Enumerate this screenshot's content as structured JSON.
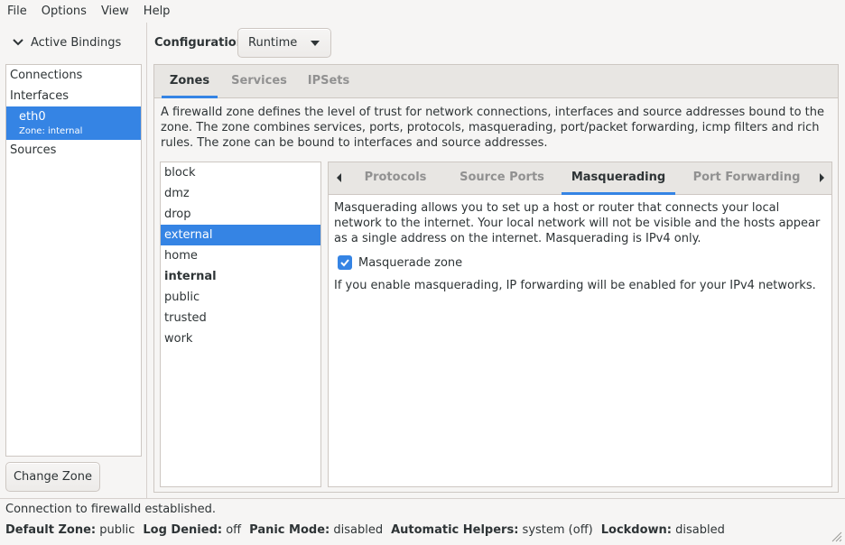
{
  "menu": [
    "File",
    "Options",
    "View",
    "Help"
  ],
  "bindings": {
    "toggle_label": "Active Bindings",
    "items": [
      {
        "label": "Connections"
      },
      {
        "label": "Interfaces"
      },
      {
        "label": "eth0",
        "sub": "Zone: internal",
        "selected": true
      },
      {
        "label": "Sources"
      }
    ],
    "change_zone_label": "Change Zone"
  },
  "config": {
    "label": "Configuration:",
    "value": "Runtime"
  },
  "main_tabs": [
    "Zones",
    "Services",
    "IPSets"
  ],
  "zone_description": "A firewalld zone defines the level of trust for network connections, interfaces and source addresses bound to the zone. The zone combines services, ports, protocols, masquerading, port/packet forwarding, icmp filters and rich rules. The zone can be bound to interfaces and source addresses.",
  "zones": [
    {
      "name": "block"
    },
    {
      "name": "dmz"
    },
    {
      "name": "drop"
    },
    {
      "name": "external",
      "selected": true
    },
    {
      "name": "home"
    },
    {
      "name": "internal",
      "bold": true
    },
    {
      "name": "public"
    },
    {
      "name": "trusted"
    },
    {
      "name": "work"
    }
  ],
  "sub_tabs": [
    "Protocols",
    "Source Ports",
    "Masquerading",
    "Port Forwarding"
  ],
  "masquerading": {
    "description": "Masquerading allows you to set up a host or router that connects your local network to the internet. Your local network will not be visible and the hosts appear as a single address on the internet. Masquerading is IPv4 only.",
    "checkbox_label": "Masquerade zone",
    "checked": true,
    "note": "If you enable masquerading, IP forwarding will be enabled for your IPv4 networks."
  },
  "status": {
    "message": "Connection to firewalld established.",
    "items": [
      {
        "key": "Default Zone:",
        "value": "public"
      },
      {
        "key": "Log Denied:",
        "value": "off"
      },
      {
        "key": "Panic Mode:",
        "value": "disabled"
      },
      {
        "key": "Automatic Helpers:",
        "value": "system (off)"
      },
      {
        "key": "Lockdown:",
        "value": "disabled"
      }
    ]
  },
  "colors": {
    "accent": "#3584e4",
    "selected_text": "#ffffff"
  },
  "icons": [
    "chevron-down-icon",
    "dropdown-arrow-icon",
    "scroll-left-icon",
    "scroll-right-icon",
    "checkmark-icon",
    "resize-grip-icon"
  ]
}
